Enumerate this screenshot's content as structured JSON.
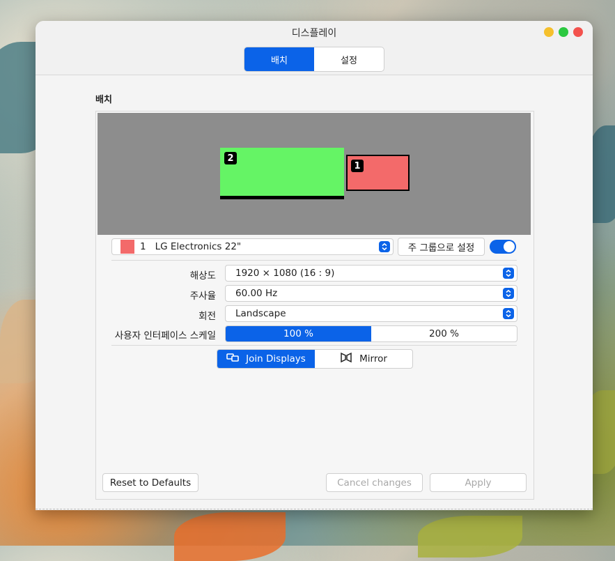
{
  "window": {
    "title": "디스플레이",
    "tabs": [
      {
        "label": "배치",
        "active": true
      },
      {
        "label": "설정",
        "active": false
      }
    ],
    "traffic_colors": [
      "#f5c02c",
      "#2bc840",
      "#f3524d"
    ]
  },
  "section_title": "배치",
  "monitors": [
    {
      "badge": "2",
      "color": "#65f465"
    },
    {
      "badge": "1",
      "color": "#f36a6a"
    }
  ],
  "display_select": {
    "number": "1",
    "name": "LG Electronics 22\"",
    "swatch_color": "#f36a6a"
  },
  "primary_button": "주 그룹으로 설정",
  "primary_toggle_on": true,
  "settings": {
    "resolution_label": "해상도",
    "resolution_value": "1920 × 1080 (16 : 9)",
    "refresh_label": "주사율",
    "refresh_value": "60.00 Hz",
    "rotation_label": "회전",
    "rotation_value": "Landscape",
    "scale_label": "사용자 인터페이스 스케일",
    "scale_options": [
      {
        "label": "100 %",
        "active": true
      },
      {
        "label": "200 %",
        "active": false
      }
    ]
  },
  "modes": [
    {
      "label": "Join Displays",
      "icon": "join-displays-icon",
      "active": true
    },
    {
      "label": "Mirror",
      "icon": "mirror-icon",
      "active": false
    }
  ],
  "footer": {
    "reset": "Reset to Defaults",
    "cancel": "Cancel changes",
    "apply": "Apply"
  },
  "colors": {
    "accent": "#0b63e8"
  }
}
